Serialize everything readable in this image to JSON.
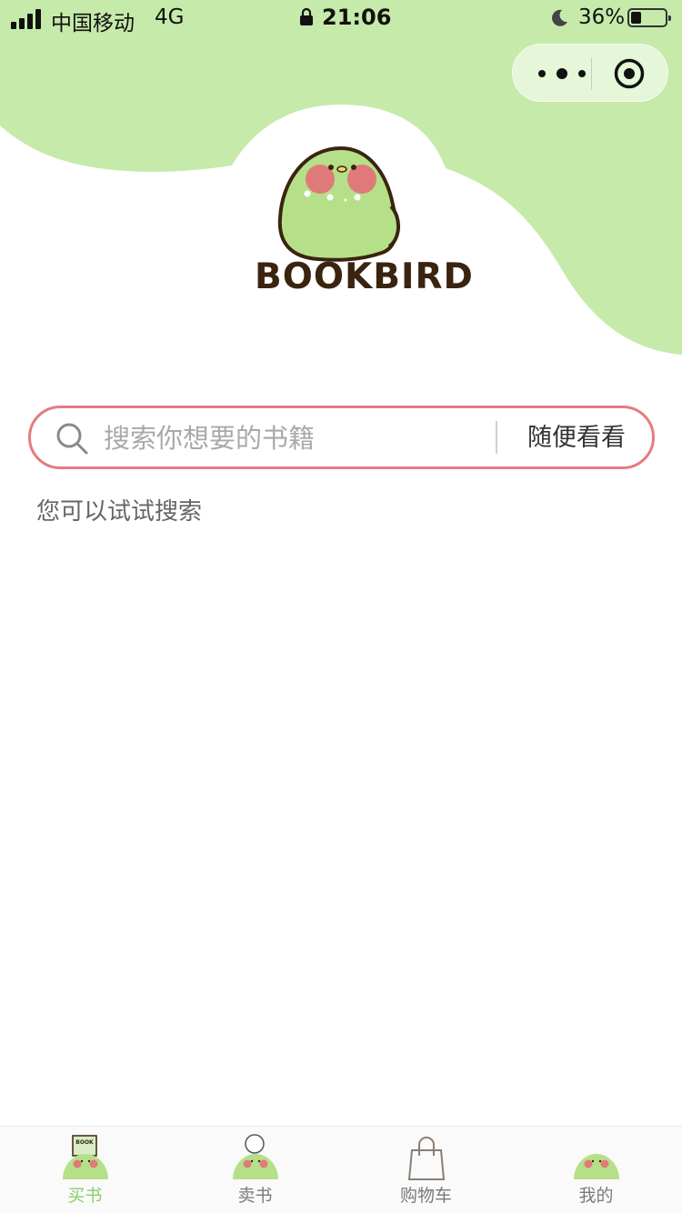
{
  "status_bar": {
    "carrier": "中国移动",
    "network": "4G",
    "time": "21:06",
    "battery_percent": "36%",
    "battery_level": 0.36
  },
  "header": {
    "brand": "BOOKBIRD",
    "theme_color": "#c6eaaa",
    "brand_color": "#3a2410"
  },
  "search": {
    "placeholder": "搜索你想要的书籍",
    "value": "",
    "random_label": "随便看看",
    "border_color": "#e57b80"
  },
  "suggestions": {
    "label": "您可以试试搜索"
  },
  "tabbar": {
    "active_color": "#8acf6b",
    "items": [
      {
        "label": "买书",
        "icon": "bird-book-icon",
        "active": true
      },
      {
        "label": "卖书",
        "icon": "bird-person-icon",
        "active": false
      },
      {
        "label": "购物车",
        "icon": "shopping-bag-icon",
        "active": false
      },
      {
        "label": "我的",
        "icon": "bird-face-icon",
        "active": false
      }
    ]
  }
}
